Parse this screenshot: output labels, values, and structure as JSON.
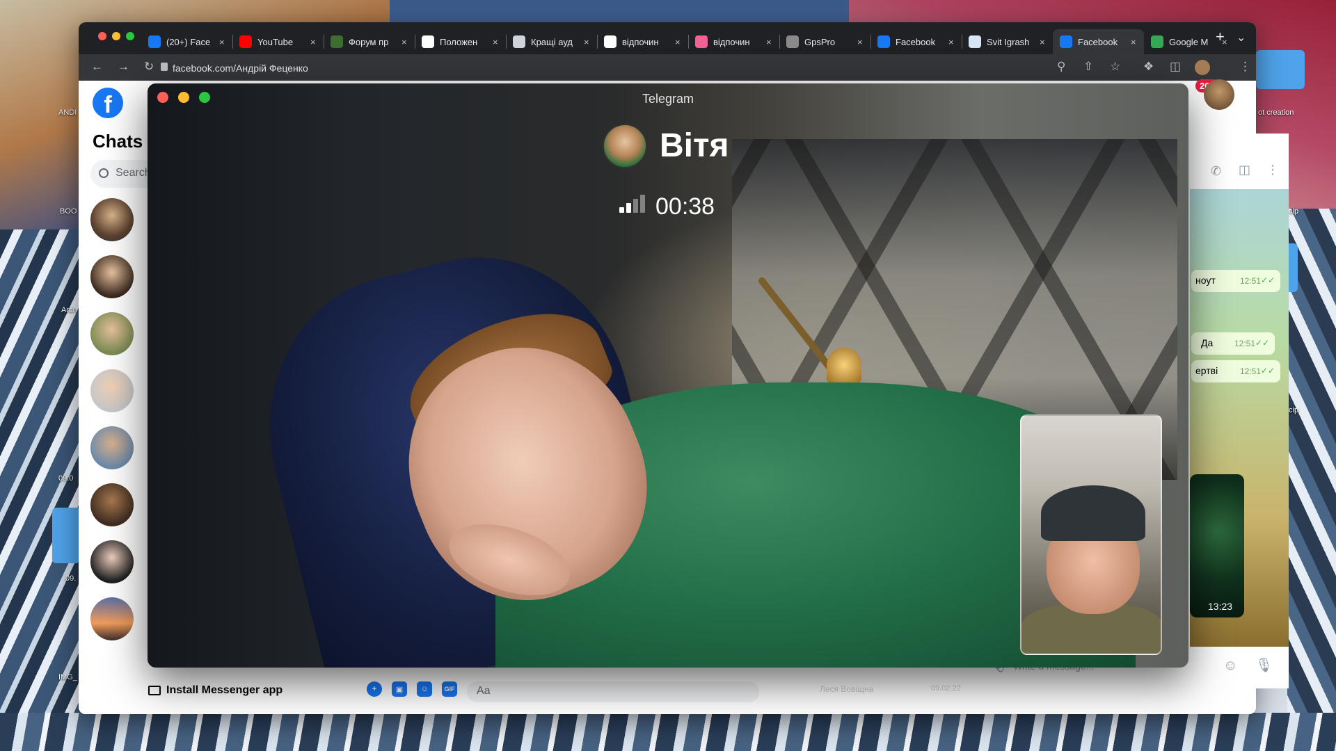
{
  "desktop": {
    "icon_labels": [
      "ANDI",
      "BOO",
      "Arch",
      "09.0",
      "09.",
      "IMG_",
      "ot creation",
      "cip",
      "cip"
    ]
  },
  "browser": {
    "tabs": [
      {
        "label": "(20+) Face",
        "favicon": "facebook-icon",
        "color": "#1877f2"
      },
      {
        "label": "YouTube",
        "favicon": "youtube-icon",
        "color": "#ff0000"
      },
      {
        "label": "Форум пр",
        "favicon": "forum-icon",
        "color": "#3c6e2f"
      },
      {
        "label": "Положен",
        "favicon": "wikipedia-icon",
        "color": "#ffffff"
      },
      {
        "label": "Кращі ауд",
        "favicon": "site-icon",
        "color": "#cfd4da"
      },
      {
        "label": "відпочин",
        "favicon": "google-icon",
        "color": "#ffffff"
      },
      {
        "label": "відпочин",
        "favicon": "flamingo-icon",
        "color": "#f06292"
      },
      {
        "label": "GpsPro",
        "favicon": "gpspro-icon",
        "color": "#8a8a8a"
      },
      {
        "label": "Facebook",
        "favicon": "facebook-icon",
        "color": "#1877f2"
      },
      {
        "label": "Svit Igrash",
        "favicon": "cloud-icon",
        "color": "#d7e6f5"
      },
      {
        "label": "Facebook",
        "favicon": "facebook-icon",
        "color": "#1877f2",
        "active": true
      },
      {
        "label": "Google M",
        "favicon": "google-maps-icon",
        "color": "#34a853"
      }
    ],
    "url": "facebook.com/Андрій Феценко",
    "notification_badge": "20+"
  },
  "facebook": {
    "logo": "f",
    "chats_title": "Chats",
    "search_placeholder": "Search",
    "install_label": "Install Messenger app",
    "composer_placeholder": "Aa",
    "composer_icons": [
      "plus-icon",
      "image-icon",
      "sticker-icon",
      "gif-icon"
    ],
    "gif_label": "GIF",
    "bottom_peek_name": "Леся Вовіщна",
    "bottom_peek_time": "09.02.22"
  },
  "telegram_chat": {
    "messages": [
      {
        "text": "ноут",
        "time": "12:51"
      },
      {
        "text": "Да",
        "time": "12:51"
      },
      {
        "text": "ертві",
        "time": "12:51"
      }
    ],
    "video_time": "13:23",
    "input_placeholder": "Write a message..."
  },
  "call": {
    "window_title": "Telegram",
    "caller_name": "Вітя",
    "duration": "00:38",
    "signal_bars_total": 4,
    "signal_bars_filled": 2
  }
}
